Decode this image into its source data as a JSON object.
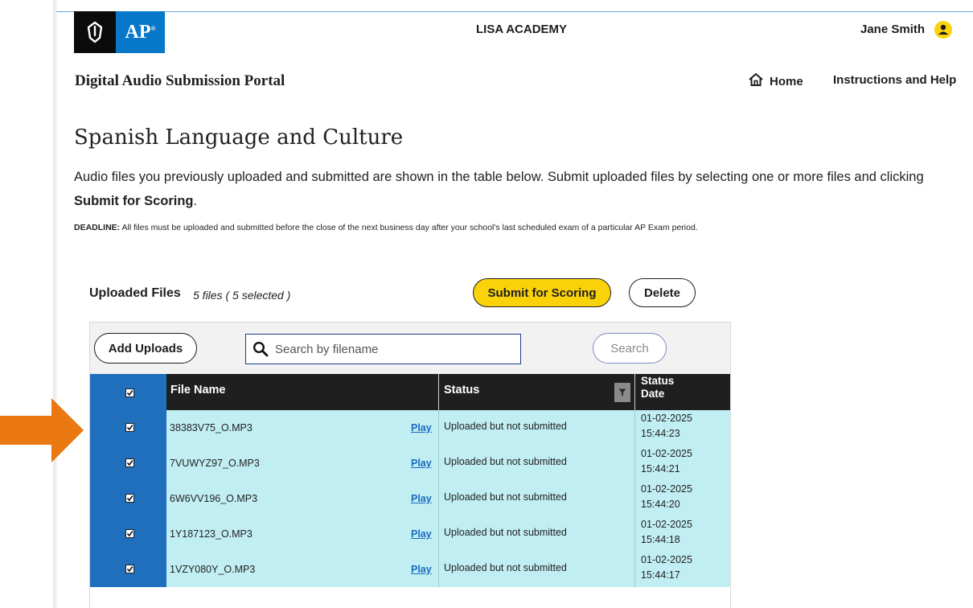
{
  "brand": {
    "logo_text": "AP"
  },
  "header": {
    "school_name": "LISA ACADEMY",
    "user_name": "Jane Smith",
    "portal_title": "Digital Audio Submission Portal",
    "nav": {
      "home_label": "Home",
      "help_label": "Instructions and Help"
    }
  },
  "main": {
    "page_title": "Spanish Language and Culture",
    "intro_text_before": "Audio files you previously uploaded and submitted are shown in the table below. Submit uploaded files by selecting one or more files and clicking ",
    "intro_bold": "Submit for Scoring",
    "intro_text_after": ".",
    "deadline_label": "DEADLINE:",
    "deadline_text": " All files must be uploaded and submitted before the close of the next business day after your school's last scheduled exam of a particular AP Exam period."
  },
  "uploads": {
    "title": "Uploaded Files",
    "subtitle": "5 files ( 5 selected )",
    "submit_label": "Submit for Scoring",
    "delete_label": "Delete",
    "add_label": "Add Uploads",
    "search_placeholder": "Search by filename",
    "search_label": "Search"
  },
  "table": {
    "headers": {
      "file_name": "File Name",
      "status": "Status",
      "status_date_line1": "Status",
      "status_date_line2": "Date"
    },
    "rows": [
      {
        "file": "38383V75_O.MP3",
        "play": "Play",
        "status": "Uploaded but not submitted",
        "date": "01-02-2025",
        "time": "15:44:23",
        "checked": true
      },
      {
        "file": "7VUWYZ97_O.MP3",
        "play": "Play",
        "status": "Uploaded but not submitted",
        "date": "01-02-2025",
        "time": "15:44:21",
        "checked": true
      },
      {
        "file": "6W6VV196_O.MP3",
        "play": "Play",
        "status": "Uploaded but not submitted",
        "date": "01-02-2025",
        "time": "15:44:20",
        "checked": true
      },
      {
        "file": "1Y187123_O.MP3",
        "play": "Play",
        "status": "Uploaded but not submitted",
        "date": "01-02-2025",
        "time": "15:44:18",
        "checked": true
      },
      {
        "file": "1VZY080Y_O.MP3",
        "play": "Play",
        "status": "Uploaded but not submitted",
        "date": "01-02-2025",
        "time": "15:44:17",
        "checked": true
      }
    ]
  },
  "icons": {
    "logo_mark": "acorn-torch-icon",
    "avatar": "user-avatar-icon",
    "home": "home-icon",
    "search": "search-icon",
    "filter": "filter-icon",
    "checkbox": "checkbox-checked-icon",
    "arrow": "arrow-right-icon"
  },
  "colors": {
    "brand_blue": "#0677c9",
    "accent_yellow": "#f9d20a",
    "row_highlight": "#c1eef3",
    "checkbox_column": "#1f6fbd",
    "header_dark": "#1f1f1f",
    "link_blue": "#1a6bbd",
    "annotation_arrow": "#e8780f"
  }
}
